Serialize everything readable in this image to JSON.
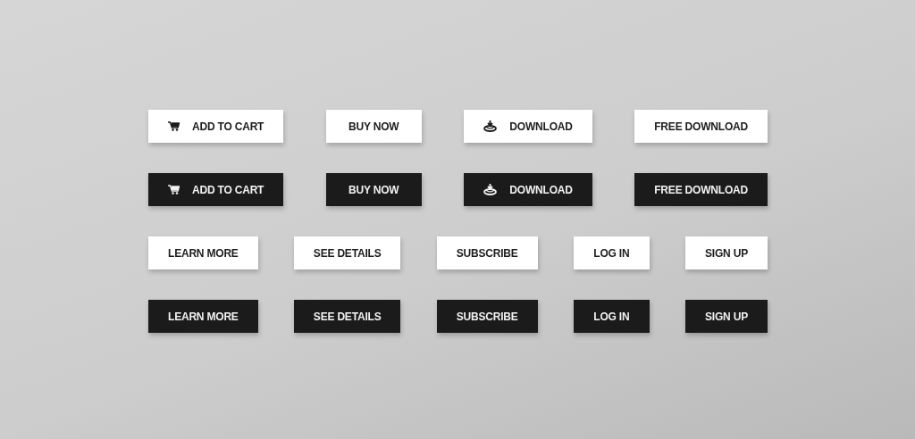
{
  "rows": [
    {
      "kind": "light",
      "buttons": [
        {
          "label": "ADD TO CART",
          "kind": "cart"
        },
        {
          "label": "BUY NOW",
          "kind": "plain"
        },
        {
          "label": "DOWNLOAD",
          "kind": "download"
        },
        {
          "label": "FREE DOWNLOAD",
          "kind": "plain"
        }
      ]
    },
    {
      "kind": "dark",
      "buttons": [
        {
          "label": "ADD TO CART",
          "kind": "cart"
        },
        {
          "label": "BUY NOW",
          "kind": "plain"
        },
        {
          "label": "DOWNLOAD",
          "kind": "download"
        },
        {
          "label": "FREE DOWNLOAD",
          "kind": "plain"
        }
      ]
    },
    {
      "kind": "light",
      "buttons": [
        {
          "label": "LEARN MORE",
          "kind": "plain"
        },
        {
          "label": "SEE DETAILS",
          "kind": "plain"
        },
        {
          "label": "SUBSCRIBE",
          "kind": "plain"
        },
        {
          "label": "LOG IN",
          "kind": "plain"
        },
        {
          "label": "SIGN UP",
          "kind": "plain"
        }
      ]
    },
    {
      "kind": "dark",
      "buttons": [
        {
          "label": "LEARN MORE",
          "kind": "plain"
        },
        {
          "label": "SEE DETAILS",
          "kind": "plain"
        },
        {
          "label": "SUBSCRIBE",
          "kind": "plain"
        },
        {
          "label": "LOG IN",
          "kind": "plain"
        },
        {
          "label": "SIGN UP",
          "kind": "plain"
        }
      ]
    }
  ]
}
